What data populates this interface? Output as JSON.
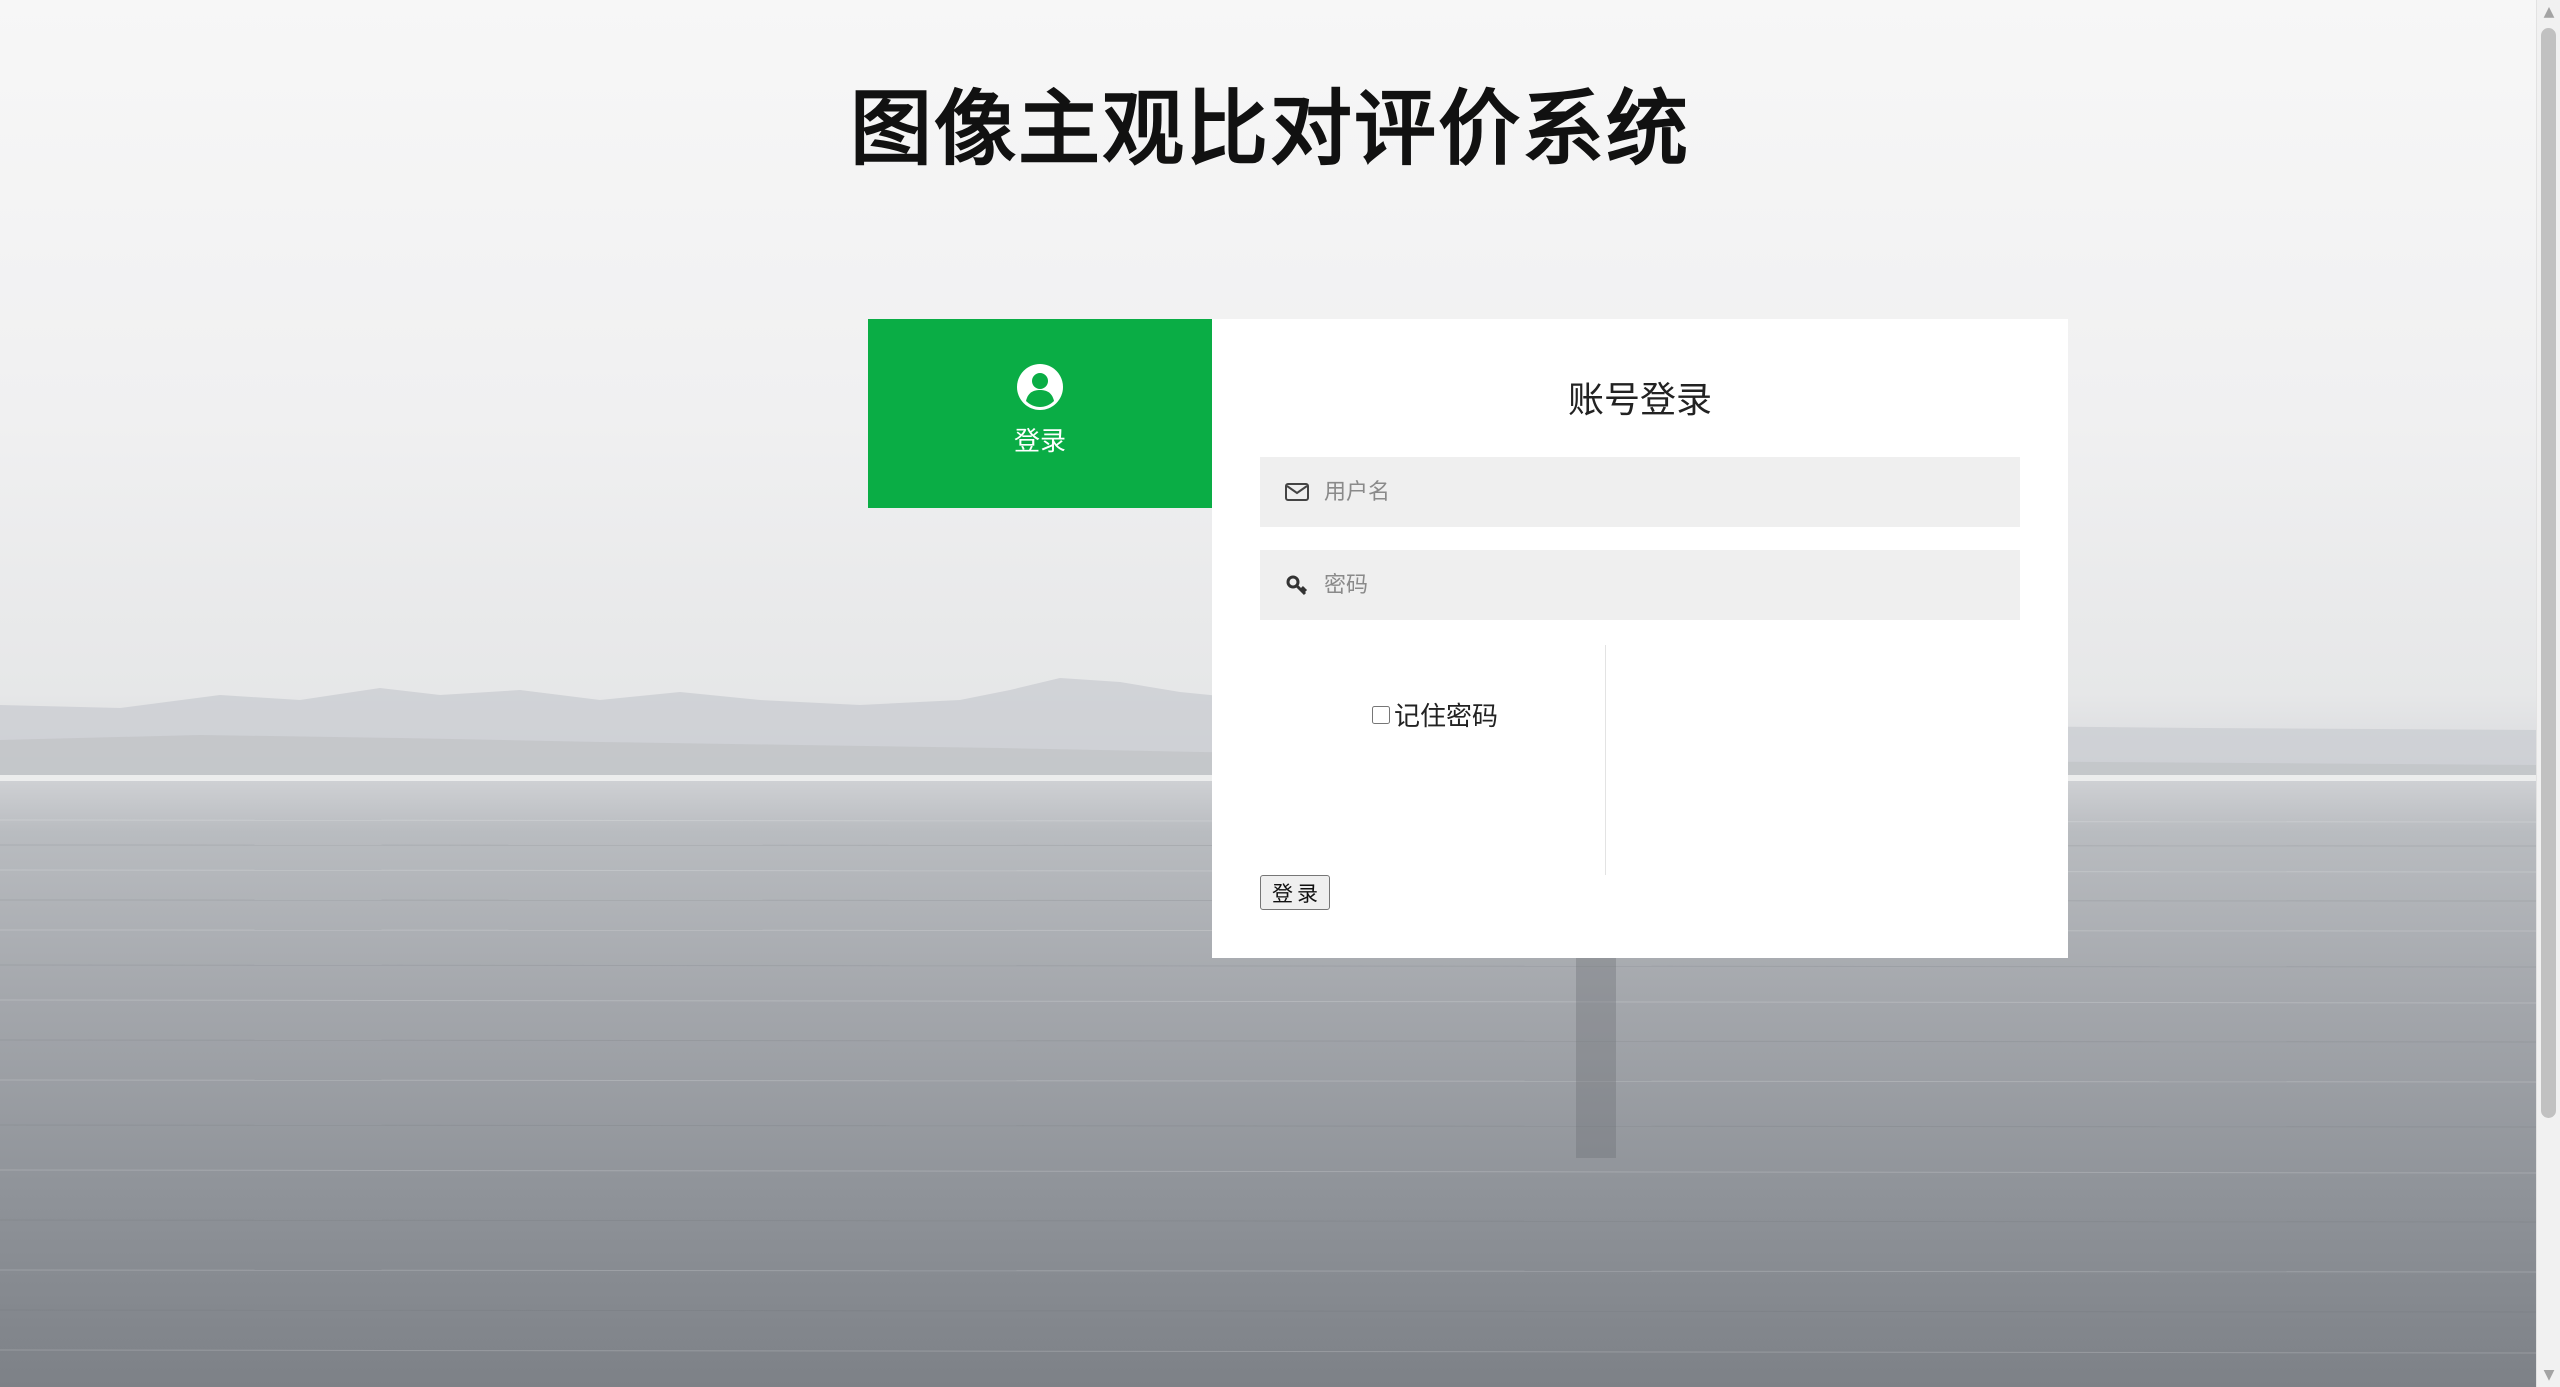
{
  "page": {
    "title": "图像主观比对评价系统"
  },
  "side_tab": {
    "icon": "user-circle-icon",
    "label": "登录",
    "color": "#0aad45"
  },
  "login_card": {
    "heading": "账号登录",
    "username": {
      "icon": "envelope-icon",
      "placeholder": "用户名",
      "value": ""
    },
    "password": {
      "icon": "key-icon",
      "placeholder": "密码",
      "value": ""
    },
    "remember": {
      "label": "记住密码",
      "checked": false
    },
    "submit_label": "登录"
  }
}
